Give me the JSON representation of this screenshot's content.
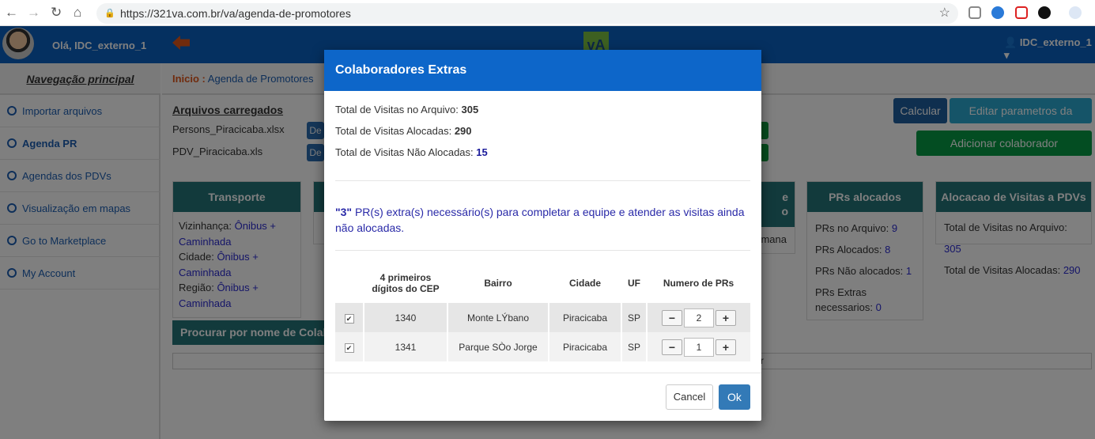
{
  "browser": {
    "url": "https://321va.com.br/va/agenda-de-promotores"
  },
  "app": {
    "greeting": "Olá, IDC_externo_1",
    "user_menu": "IDC_externo_1",
    "logo": "vA",
    "accent": "#0b60c0"
  },
  "sidebar": {
    "title": "Navegação principal",
    "items": [
      {
        "label": "Importar arquivos"
      },
      {
        "label": "Agenda PR"
      },
      {
        "label": "Agendas dos PDVs"
      },
      {
        "label": "Visualização em mapas"
      },
      {
        "label": "Go to Marketplace"
      },
      {
        "label": "My Account"
      }
    ]
  },
  "breadcrumb": {
    "home": "Inicio :",
    "current": "Agenda de Promotores"
  },
  "files": {
    "title": "Arquivos carregados",
    "items": [
      {
        "name": "Persons_Piracicaba.xlsx",
        "button": "De"
      },
      {
        "name": "PDV_Piracicaba.xls",
        "button": "De"
      }
    ]
  },
  "actions": {
    "calcular": "Calcular",
    "editar": "Editar parametros da Agenda",
    "adicionar": "Adicionar colaborador manualmente"
  },
  "transporte": {
    "title": "Transporte",
    "lines": [
      {
        "label": "Vizinhança:",
        "value": "Ônibus + Caminhada"
      },
      {
        "label": "Cidade:",
        "value": "Ônibus + Caminhada"
      },
      {
        "label": "Região:",
        "value": "Ônibus + Caminhada"
      }
    ]
  },
  "partial": {
    "header_fragment": "e\no",
    "text_fragment": "mana",
    "search_title": "Procurar por nome de Colaborador",
    "search_fragment": "or"
  },
  "prs": {
    "title": "PRs alocados",
    "lines": [
      {
        "label": "PRs no Arquivo:",
        "value": "9"
      },
      {
        "label": "PRs Alocados:",
        "value": "8"
      },
      {
        "label": "PRs Não alocados:",
        "value": "1"
      },
      {
        "label": "PRs Extras necessarios:",
        "value": "0"
      }
    ]
  },
  "visitas": {
    "title": "Alocacao de Visitas a PDVs",
    "lines": [
      {
        "label": "Total de Visitas no Arquivo:",
        "value": "305"
      },
      {
        "label": "Total de Visitas Alocadas:",
        "value": "290"
      }
    ]
  },
  "modal": {
    "title": "Colaboradores Extras",
    "stats": [
      {
        "label": "Total de Visitas no Arquivo:",
        "value": "305"
      },
      {
        "label": "Total de Visitas Alocadas:",
        "value": "290"
      },
      {
        "label": "Total de Visitas Não Alocadas:",
        "value": "15"
      }
    ],
    "message_count": "\"3\"",
    "message": " PR(s) extra(s) necessário(s) para completar a equipe e atender as visitas ainda não alocadas.",
    "columns": [
      "4 primeiros dígitos do CEP",
      "Bairro",
      "Cidade",
      "UF",
      "Numero de PRs"
    ],
    "rows": [
      {
        "checked": true,
        "cep": "1340",
        "bairro": "Monte LÝbano",
        "cidade": "Piracicaba",
        "uf": "SP",
        "prs": "2"
      },
      {
        "checked": true,
        "cep": "1341",
        "bairro": "Parque SÒo Jorge",
        "cidade": "Piracicaba",
        "uf": "SP",
        "prs": "1"
      }
    ],
    "cancel": "Cancel",
    "ok": "Ok"
  }
}
